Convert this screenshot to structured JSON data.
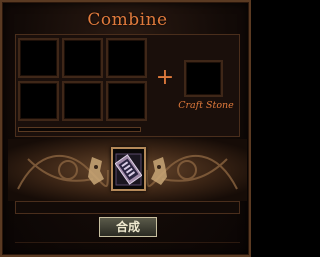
{
  "window": {
    "title": "Combine"
  },
  "material_slots": [
    {
      "id": "slot-1",
      "item": null
    },
    {
      "id": "slot-2",
      "item": null
    },
    {
      "id": "slot-3",
      "item": null
    },
    {
      "id": "slot-4",
      "item": null
    },
    {
      "id": "slot-5",
      "item": null
    },
    {
      "id": "slot-6",
      "item": null
    }
  ],
  "operator": "+",
  "craft_stone": {
    "label": "Craft Stone",
    "item": null
  },
  "progress": {
    "fraction": 0
  },
  "result": {
    "item_icon": "scroll-icon",
    "colors": {
      "border": "#b58a5a",
      "item_frame": "#a08aa8",
      "item_body": "#2a2440"
    }
  },
  "buttons": {
    "combine_label": "合成"
  },
  "colors": {
    "title": "#e07a3c",
    "label": "#e07a3c",
    "frame": "#5a3a22",
    "background": "#120a07"
  }
}
